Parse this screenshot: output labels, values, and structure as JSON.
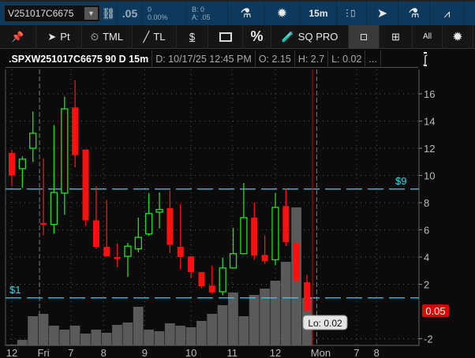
{
  "toolbar": {
    "symbol": "V251017C6675",
    "last": ".05",
    "change": "0",
    "change_pct": "0.00%",
    "bid": "B: 0",
    "ask": "A: .05",
    "timeframe": "15m"
  },
  "toolbar2": {
    "pt": "Pt",
    "tml": "TML",
    "tl": "TL",
    "dollar": "$",
    "percent": "%",
    "sqpro": "SQ PRO",
    "all": "All"
  },
  "header": {
    "title": ".SPXW251017C6675 90 D 15m",
    "date": "D: 10/17/25 12:45 PM",
    "open": "O: 2.15",
    "high": "H: 2.7",
    "low": "L: 0.02",
    "more": "..."
  },
  "colors": {
    "up": "#22e022",
    "down": "#ff1010",
    "level": "#1ee0f0",
    "volume": "#5a5a5a",
    "toolbar": "#0d3a5c"
  },
  "chart_data": {
    "type": "candlestick",
    "ylim": [
      -2.9,
      17.5
    ],
    "yticks": [
      -2,
      2,
      4,
      6,
      8,
      10,
      12,
      14,
      16
    ],
    "ytick_labels": [
      "-2",
      "2",
      "4",
      "6",
      "8",
      "10",
      "12",
      "14",
      "16"
    ],
    "xtick_labels": [
      {
        "label": "12",
        "bar": 0
      },
      {
        "label": "Fri",
        "bar": 3
      },
      {
        "label": "7",
        "bar": 5.6
      },
      {
        "label": "8",
        "bar": 8.7
      },
      {
        "label": "9",
        "bar": 12.6
      },
      {
        "label": "10",
        "bar": 17
      },
      {
        "label": "11",
        "bar": 20.9
      },
      {
        "label": "12",
        "bar": 25
      },
      {
        "label": "Mon",
        "bar": 29.3
      },
      {
        "label": "7",
        "bar": 32.7
      },
      {
        "label": "8",
        "bar": 34.6
      }
    ],
    "candles": [
      [
        11.65,
        11.9,
        9.2,
        10.0
      ],
      [
        10.5,
        11.4,
        9.1,
        11.2
      ],
      [
        12.0,
        14.7,
        11.0,
        13.1
      ],
      [
        6.5,
        11.25,
        5.6,
        6.4
      ],
      [
        6.4,
        13.7,
        5.7,
        8.75
      ],
      [
        8.7,
        15.8,
        7.1,
        14.9
      ],
      [
        15.0,
        17.0,
        10.6,
        11.5
      ],
      [
        11.9,
        11.9,
        6.3,
        6.7
      ],
      [
        6.7,
        9.2,
        4.6,
        4.75
      ],
      [
        4.75,
        8.2,
        4.05,
        4.05
      ],
      [
        4.0,
        5.0,
        3.25,
        3.85
      ],
      [
        4.05,
        5.05,
        2.55,
        4.8
      ],
      [
        4.6,
        6.9,
        4.35,
        5.45
      ],
      [
        5.7,
        8.7,
        5.55,
        7.2
      ],
      [
        7.3,
        8.75,
        6.1,
        7.5
      ],
      [
        7.6,
        8.9,
        4.3,
        4.9
      ],
      [
        4.75,
        7.9,
        3.1,
        4.0
      ],
      [
        4.05,
        4.05,
        2.45,
        2.9
      ],
      [
        2.9,
        2.9,
        1.7,
        1.85
      ],
      [
        1.9,
        3.35,
        1.3,
        1.4
      ],
      [
        1.45,
        3.95,
        1.2,
        3.2
      ],
      [
        3.2,
        6.15,
        3.2,
        4.25
      ],
      [
        4.25,
        9.45,
        4.25,
        6.9
      ],
      [
        6.9,
        8.0,
        3.8,
        4.1
      ],
      [
        4.15,
        5.6,
        3.5,
        3.7
      ],
      [
        3.8,
        8.7,
        3.4,
        7.65
      ],
      [
        7.75,
        9.05,
        4.8,
        5.1
      ],
      [
        5.05,
        5.05,
        2.0,
        2.25
      ],
      [
        2.15,
        2.7,
        0.02,
        0.05
      ]
    ],
    "volume": [
      1,
      7,
      37,
      40,
      25,
      20,
      25,
      15,
      20,
      16,
      26,
      29,
      49,
      20,
      18,
      28,
      25,
      23,
      31,
      40,
      51,
      67,
      37,
      64,
      72,
      82,
      106,
      175,
      60
    ],
    "levels": [
      {
        "label": "$9",
        "value": 9
      },
      {
        "label": "$1",
        "value": 1
      }
    ],
    "last_price_label": "0.05",
    "low_bubble": "Lo: 0.02"
  }
}
